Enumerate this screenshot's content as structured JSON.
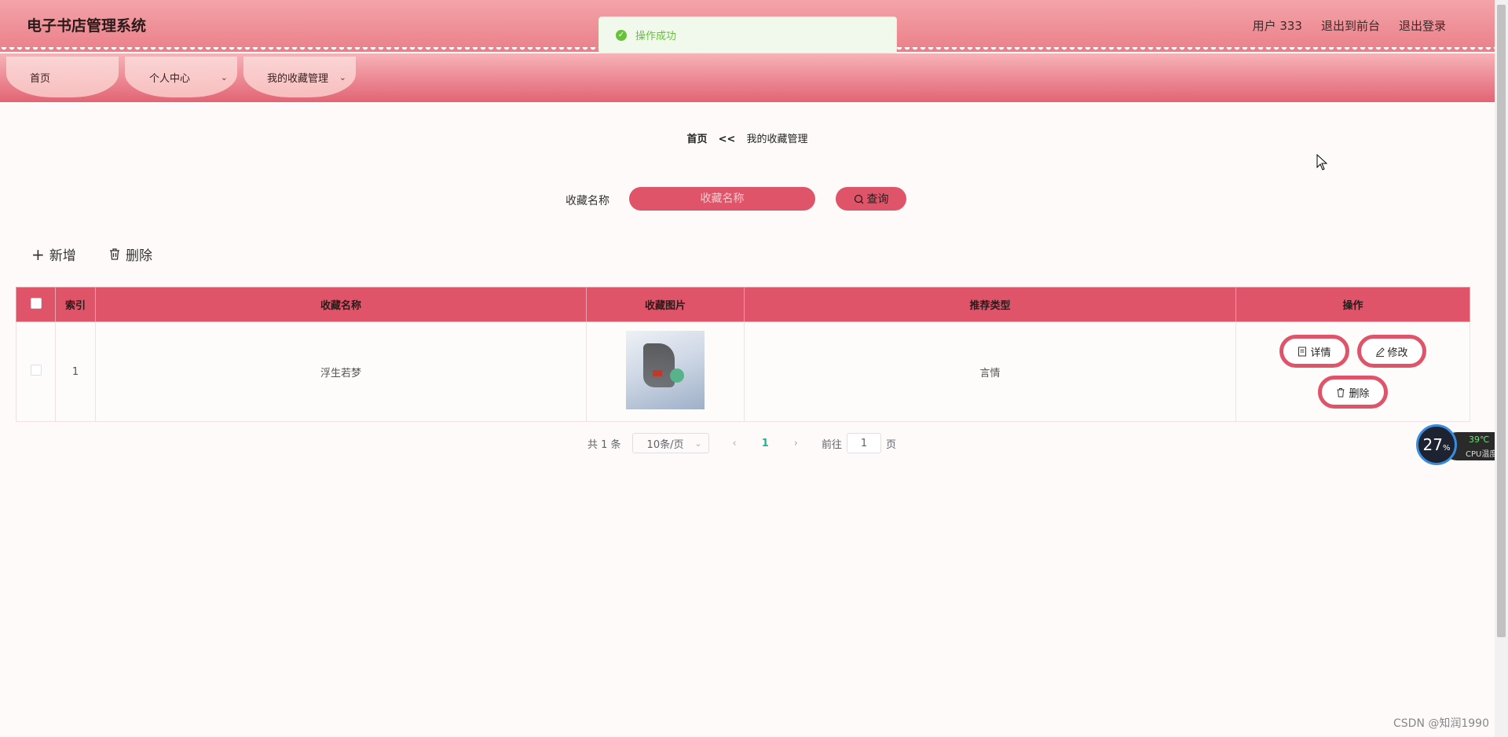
{
  "header": {
    "app_title": "电子书店管理系统",
    "user_text": "用户 333",
    "back_to_front": "退出到前台",
    "logout": "退出登录"
  },
  "nav": {
    "items": [
      {
        "label": "首页"
      },
      {
        "label": "个人中心"
      },
      {
        "label": "我的收藏管理"
      }
    ]
  },
  "toast": {
    "message": "操作成功"
  },
  "breadcrumb": {
    "home": "首页",
    "separator": "<<",
    "current": "我的收藏管理"
  },
  "search": {
    "label": "收藏名称",
    "placeholder": "收藏名称",
    "button": "查询"
  },
  "actions": {
    "add": "新增",
    "delete": "删除"
  },
  "table": {
    "headers": [
      "索引",
      "收藏名称",
      "收藏图片",
      "推荐类型",
      "操作"
    ],
    "rows": [
      {
        "index": "1",
        "name": "浮生若梦",
        "type": "言情"
      }
    ],
    "op_labels": {
      "detail": "详情",
      "edit": "修改",
      "delete": "删除"
    }
  },
  "pagination": {
    "total_text": "共 1 条",
    "page_size": "10条/页",
    "current_page": "1",
    "goto_label": "前往",
    "goto_value": "1",
    "page_suffix": "页"
  },
  "widget": {
    "cpu_percent": "27",
    "percent_sign": "%",
    "temperature": "39℃",
    "label": "CPU温度"
  },
  "watermark": "CSDN @知润1990",
  "colors": {
    "primary": "#df5468",
    "success": "#67c23a",
    "pager_active": "#17b890"
  }
}
